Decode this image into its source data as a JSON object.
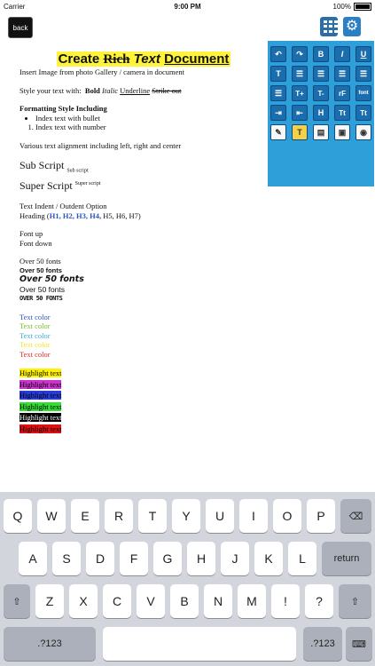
{
  "status": {
    "carrier": "Carrier",
    "time": "9:00 PM",
    "battery": "100%"
  },
  "toolbar": {
    "back_label": "back"
  },
  "doc": {
    "title_pre": "Create",
    "title_strike": "Rich",
    "title_italic": "Text",
    "title_under": "Document",
    "insert_image": "Insert Image from photo Gallery / camera in document",
    "style_prefix": "Style your text with:",
    "style_bold": "Bold",
    "style_italic": "Italic",
    "style_underline": "Underline",
    "style_strike": "Strike out",
    "formatting_heading": "Formatting Style Including",
    "bullet_item": "Index text with bullet",
    "number_item": "Index text with number",
    "alignment": "Various text alignment including left, right and center",
    "subscript_main": "Sub Script",
    "subscript_small": "Sub script",
    "superscript_main": "Super Script",
    "superscript_small": "Super script",
    "indent": "Text Indent / Outdent Option",
    "heading_prefix": "Heading (",
    "headings": [
      "H1,",
      "H2,",
      "H3,",
      "H4,",
      "H5,",
      "H6,",
      "H7)"
    ],
    "font_up": "Font up",
    "font_down": "Font down",
    "fonts": [
      "Over 50 fonts",
      "Over 50 fonts",
      "Over 50 fonts",
      "Over 50 fonts",
      "OVER 50 FONTS"
    ],
    "text_colors": [
      {
        "label": "Text color",
        "color": "#2b57b8"
      },
      {
        "label": "Text color",
        "color": "#7cbb2a"
      },
      {
        "label": "Text color",
        "color": "#3aa9e0"
      },
      {
        "label": "Text color",
        "color": "#f2e521"
      },
      {
        "label": "Text color",
        "color": "#d42b2b"
      }
    ],
    "highlights": [
      {
        "label": "Highlight text",
        "bg": "#fff200",
        "fg": "#000"
      },
      {
        "label": "Highlight text",
        "bg": "#cc33cc",
        "fg": "#000"
      },
      {
        "label": "Highlight text",
        "bg": "#2a3ad6",
        "fg": "#000"
      },
      {
        "label": "Highlight text",
        "bg": "#33dd33",
        "fg": "#000"
      },
      {
        "label": "Highlight text",
        "bg": "#000000",
        "fg": "#fff"
      },
      {
        "label": "Highlight text",
        "bg": "#dd1111",
        "fg": "#000"
      }
    ]
  },
  "panel": {
    "rows": [
      [
        "undo-icon",
        "redo-icon",
        "B",
        "I",
        "U"
      ],
      [
        "T",
        "list-icon",
        "list-icon",
        "list-icon",
        "list-icon"
      ],
      [
        "align-icon",
        "T+",
        "T-",
        "rF",
        "font"
      ],
      [
        "indent-icon",
        "outdent-icon",
        "H",
        "Tt",
        "Tt"
      ],
      [
        "color-pencils-icon",
        "T",
        "highlight-icon",
        "image-icon",
        "camera-icon"
      ]
    ]
  },
  "keyboard": {
    "row1": [
      "Q",
      "W",
      "E",
      "R",
      "T",
      "Y",
      "U",
      "I",
      "O",
      "P"
    ],
    "row2": [
      "A",
      "S",
      "D",
      "F",
      "G",
      "H",
      "J",
      "K",
      "L"
    ],
    "row3": [
      "Z",
      "X",
      "C",
      "V",
      "B",
      "N",
      "M",
      "!",
      "?"
    ],
    "return": "return",
    "mode_left": ".?123",
    "mode_right": ".?123"
  }
}
